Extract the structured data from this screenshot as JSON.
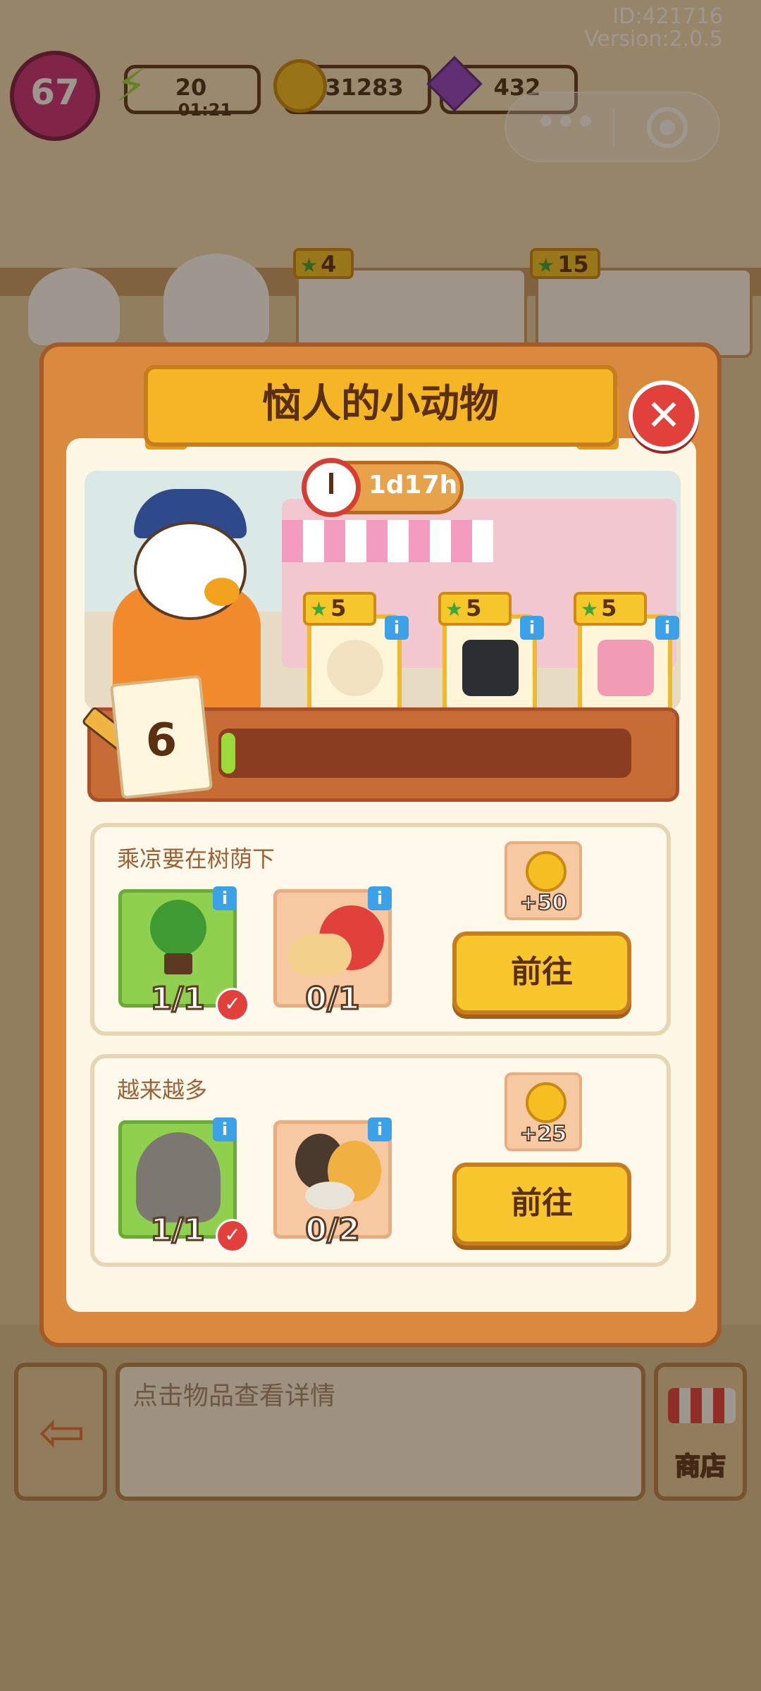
{
  "hud": {
    "level": "67",
    "energy": "20",
    "energy_timer": "01:21",
    "coins": "31283",
    "gems": "432",
    "id_text": "ID:421716",
    "version_text": "Version:2.0.5"
  },
  "background_shelf": {
    "item1_stars": "4",
    "item2_stars": "15"
  },
  "modal": {
    "title": "恼人的小动物",
    "timer": "1d17h",
    "rewards": [
      {
        "stars": "5",
        "icon": "hamster-sleeping"
      },
      {
        "stars": "5",
        "icon": "black-bag"
      },
      {
        "stars": "5",
        "icon": "pink-bag"
      }
    ],
    "progress_count": "6",
    "progress_fraction": 0.03
  },
  "tasks": [
    {
      "title": "乘凉要在树荫下",
      "items": [
        {
          "icon": "potted-tree",
          "count": "1/1",
          "done": true
        },
        {
          "icon": "snail",
          "count": "0/1",
          "done": false
        }
      ],
      "reward": "+50",
      "button": "前往"
    },
    {
      "title": "越来越多",
      "items": [
        {
          "icon": "garbage-bag",
          "count": "1/1",
          "done": true
        },
        {
          "icon": "hamsters",
          "count": "0/2",
          "done": false
        }
      ],
      "reward": "+25",
      "button": "前往"
    }
  ],
  "bottom": {
    "detail_placeholder": "点击物品查看详情",
    "shop_label": "商店"
  },
  "colors": {
    "accent": "#f5b626",
    "close": "#e2413b",
    "done_slot": "#8fd14f",
    "progress": "#9bd93c"
  }
}
